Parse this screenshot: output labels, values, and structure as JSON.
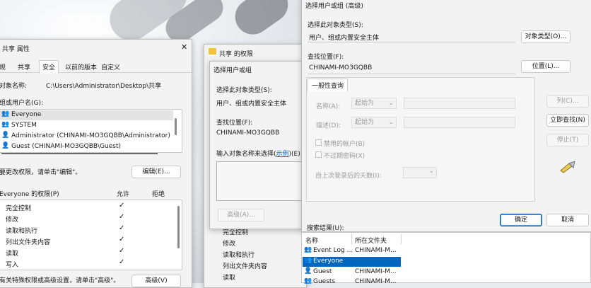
{
  "props": {
    "title": "共享 属性",
    "tabs": [
      "规",
      "共享",
      "安全",
      "以前的版本",
      "自定义"
    ],
    "object_label": "对象名称:",
    "object_path": "C:\\Users\\Administrator\\Desktop\\共享",
    "groups_label": "组或用户名(G):",
    "users": [
      "Everyone",
      "SYSTEM",
      "Administrator (CHINAMI-MO3GQBB\\Administrator)",
      "Guest (CHINAMI-MO3GQBB\\Guest)"
    ],
    "edit_hint": "要更改权限，请单击\"编辑\"。",
    "edit_button": "编辑(E)...",
    "perm_header": "Everyone 的权限(P)",
    "allow": "允许",
    "deny": "拒绝",
    "permissions": [
      "完全控制",
      "修改",
      "读取和执行",
      "列出文件夹内容",
      "读取",
      "写入"
    ],
    "adv_hint": "有关特殊权限或高级设置，请单击\"高级\"。",
    "adv_button": "高级(V)"
  },
  "perm_dialog": {
    "title": "共享 的权限",
    "perm_items": [
      "完全控制",
      "修改",
      "读取和执行",
      "列出文件夹内容",
      "读取"
    ]
  },
  "select_small": {
    "title": "选择用户或组",
    "type_label": "选择此对象类型(S):",
    "type_value": "用户、组或内置安全主体",
    "loc_label": "查找位置(F):",
    "loc_value": "CHINAMI-MO3GQBB",
    "names_label_pre": "输入对象名称来选择(",
    "names_link": "示例",
    "names_label_post": ")(E):",
    "advanced_button": "高级(A)..."
  },
  "select_big": {
    "title": "选择用户或组 (高级)",
    "type_label": "选择此对象类型(S):",
    "type_value": "用户、组或内置安全主体",
    "type_button": "对象类型(O)...",
    "loc_label": "查找位置(F):",
    "loc_value": "CHINAMI-MO3GQBB",
    "loc_button": "位置(L)...",
    "tab_general": "一般性查询",
    "name_label": "名称(A):",
    "desc_label": "描述(D):",
    "starts_with": "起始为",
    "columns_button": "列(C)...",
    "find_button": "立即查找(N)",
    "stop_button": "停止(T)",
    "disabled_accounts": "禁用的帐户(B)",
    "no_expire": "不过期密码(X)",
    "days_label": "自上次登录后的天数(I):",
    "ok": "确定",
    "cancel": "取消",
    "results_label": "搜索结果(U):",
    "col_name": "名称",
    "col_folder": "所在文件夹",
    "results": [
      {
        "name": "Event Log ...",
        "folder": "CHINAMI-M..."
      },
      {
        "name": "Everyone",
        "folder": ""
      },
      {
        "name": "Guest",
        "folder": "CHINAMI-M..."
      },
      {
        "name": "Guests",
        "folder": "CHINAMI-M..."
      }
    ]
  },
  "colors": {
    "accent": "#0067c0",
    "selection": "#0067c0",
    "link": "#0066cc"
  }
}
